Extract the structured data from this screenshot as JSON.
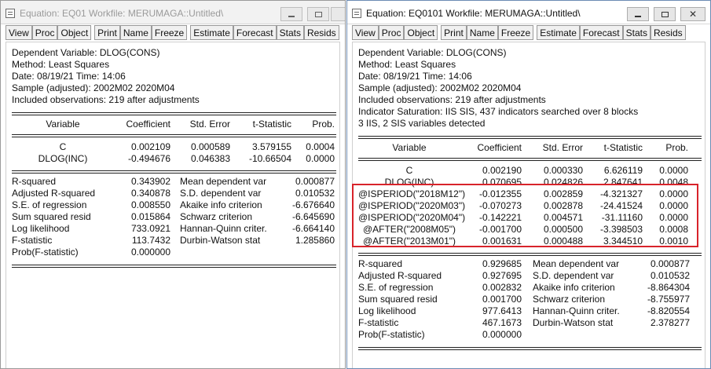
{
  "left_window": {
    "title": "Equation: EQ01   Workfile: MERUMAGA::Untitled\\",
    "toolbar": [
      "View",
      "Proc",
      "Object",
      "Print",
      "Name",
      "Freeze",
      "Estimate",
      "Forecast",
      "Stats",
      "Resids"
    ],
    "header": [
      "Dependent Variable: DLOG(CONS)",
      "Method: Least Squares",
      "Date: 08/19/21   Time: 14:06",
      "Sample (adjusted): 2002M02 2020M04",
      "Included observations: 219 after adjustments"
    ],
    "columns": [
      "Variable",
      "Coefficient",
      "Std. Error",
      "t-Statistic",
      "Prob."
    ],
    "rows": [
      {
        "variable": "C",
        "coef": "0.002109",
        "se": "0.000589",
        "t": "3.579155",
        "p": "0.0004"
      },
      {
        "variable": "DLOG(INC)",
        "coef": "-0.494676",
        "se": "0.046383",
        "t": "-10.66504",
        "p": "0.0000"
      }
    ],
    "stats": [
      {
        "label": "R-squared",
        "value": "0.343902",
        "label2": "Mean dependent var",
        "value2": "0.000877"
      },
      {
        "label": "Adjusted R-squared",
        "value": "0.340878",
        "label2": "S.D. dependent var",
        "value2": "0.010532"
      },
      {
        "label": "S.E. of regression",
        "value": "0.008550",
        "label2": "Akaike info criterion",
        "value2": "-6.676640"
      },
      {
        "label": "Sum squared resid",
        "value": "0.015864",
        "label2": "Schwarz criterion",
        "value2": "-6.645690"
      },
      {
        "label": "Log likelihood",
        "value": "733.0921",
        "label2": "Hannan-Quinn criter.",
        "value2": "-6.664140"
      },
      {
        "label": "F-statistic",
        "value": "113.7432",
        "label2": "Durbin-Watson stat",
        "value2": "1.285860"
      },
      {
        "label": "Prob(F-statistic)",
        "value": "0.000000",
        "label2": "",
        "value2": ""
      }
    ]
  },
  "right_window": {
    "title": "Equation: EQ0101   Workfile: MERUMAGA::Untitled\\",
    "toolbar": [
      "View",
      "Proc",
      "Object",
      "Print",
      "Name",
      "Freeze",
      "Estimate",
      "Forecast",
      "Stats",
      "Resids"
    ],
    "header": [
      "Dependent Variable: DLOG(CONS)",
      "Method: Least Squares",
      "Date: 08/19/21   Time: 14:06",
      "Sample (adjusted): 2002M02 2020M04",
      "Included observations: 219 after adjustments",
      "Indicator Saturation: IIS SIS, 437 indicators searched over 8 blocks",
      "3 IIS, 2 SIS variables detected"
    ],
    "columns": [
      "Variable",
      "Coefficient",
      "Std. Error",
      "t-Statistic",
      "Prob."
    ],
    "rows": [
      {
        "variable": "C",
        "coef": "0.002190",
        "se": "0.000330",
        "t": "6.626119",
        "p": "0.0000"
      },
      {
        "variable": "DLOG(INC)",
        "coef": "0.070695",
        "se": "0.024826",
        "t": "2.847641",
        "p": "0.0048"
      },
      {
        "variable": "@ISPERIOD(\"2018M12\")",
        "coef": "-0.012355",
        "se": "0.002859",
        "t": "-4.321327",
        "p": "0.0000"
      },
      {
        "variable": "@ISPERIOD(\"2020M03\")",
        "coef": "-0.070273",
        "se": "0.002878",
        "t": "-24.41524",
        "p": "0.0000"
      },
      {
        "variable": "@ISPERIOD(\"2020M04\")",
        "coef": "-0.142221",
        "se": "0.004571",
        "t": "-31.11160",
        "p": "0.0000"
      },
      {
        "variable": "@AFTER(\"2008M05\")",
        "coef": "-0.001700",
        "se": "0.000500",
        "t": "-3.398503",
        "p": "0.0008"
      },
      {
        "variable": "@AFTER(\"2013M01\")",
        "coef": "0.001631",
        "se": "0.000488",
        "t": "3.344510",
        "p": "0.0010"
      }
    ],
    "stats": [
      {
        "label": "R-squared",
        "value": "0.929685",
        "label2": "Mean dependent var",
        "value2": "0.000877"
      },
      {
        "label": "Adjusted R-squared",
        "value": "0.927695",
        "label2": "S.D. dependent var",
        "value2": "0.010532"
      },
      {
        "label": "S.E. of regression",
        "value": "0.002832",
        "label2": "Akaike info criterion",
        "value2": "-8.864304"
      },
      {
        "label": "Sum squared resid",
        "value": "0.001700",
        "label2": "Schwarz criterion",
        "value2": "-8.755977"
      },
      {
        "label": "Log likelihood",
        "value": "977.6413",
        "label2": "Hannan-Quinn criter.",
        "value2": "-8.820554"
      },
      {
        "label": "F-statistic",
        "value": "467.1673",
        "label2": "Durbin-Watson stat",
        "value2": "2.378277"
      },
      {
        "label": "Prob(F-statistic)",
        "value": "0.000000",
        "label2": "",
        "value2": ""
      }
    ]
  },
  "highlight_color": "#d8232a"
}
